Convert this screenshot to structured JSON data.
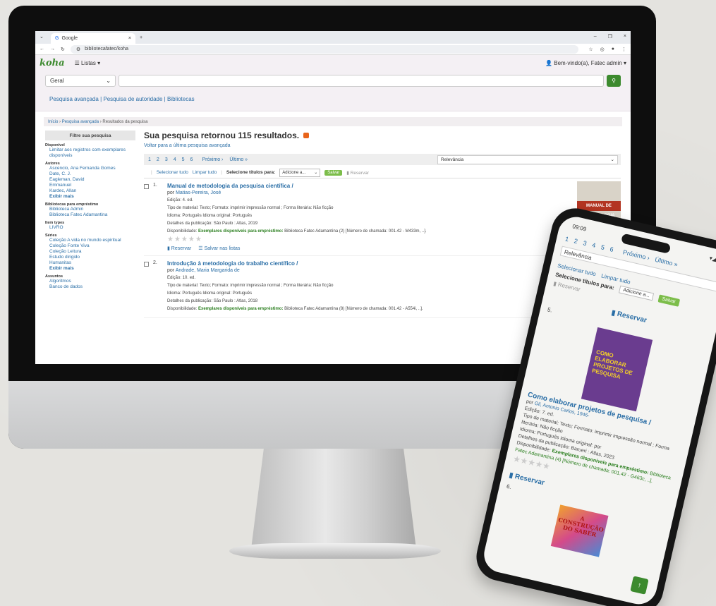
{
  "browser": {
    "tab_title": "Google",
    "url": "bibliotecafatec/koha"
  },
  "header": {
    "logo": "koha",
    "lists": "Listas",
    "welcome": "Bem-vindo(a), Fatec admin"
  },
  "search": {
    "index_selected": "Geral"
  },
  "links": {
    "advanced": "Pesquisa avançada",
    "authority": "Pesquisa de autoridade",
    "libraries": "Bibliotecas",
    "sep": "|"
  },
  "breadcrumb": {
    "home": "Início",
    "advanced": "Pesquisa avançada",
    "current": "Resultados da pesquisa"
  },
  "facets": {
    "title": "Filtre sua pesquisa",
    "groups": [
      {
        "label": "Disponível",
        "items": [
          "Limitar aos registros com exemplares disponíveis"
        ],
        "more": ""
      },
      {
        "label": "Autores",
        "items": [
          "Ascencio, Ana Fernanda Gomes",
          "Date, C. J.",
          "Eagleman, David",
          "Emmanuel",
          "Kardec, Allan"
        ],
        "more": "Exibir mais"
      },
      {
        "label": "Bibliotecas para empréstimo",
        "items": [
          "Biblioteca Admin",
          "Biblioteca Fatec Adamantina"
        ],
        "more": ""
      },
      {
        "label": "Item types",
        "items": [
          "LIVRO"
        ],
        "more": ""
      },
      {
        "label": "Séries",
        "items": [
          "Coleção A vida no mundo espiritual",
          "Coleção Fonte Viva",
          "Coleção Leitura",
          "Estudo dirigido",
          "Humanitas"
        ],
        "more": "Exibir mais"
      },
      {
        "label": "Assuntos",
        "items": [
          "Algoritmos",
          "Banco de dados"
        ],
        "more": ""
      }
    ]
  },
  "results": {
    "heading": "Sua pesquisa retornou 115 resultados.",
    "back_link": "Voltar para a última pesquisa avançada",
    "pages": [
      "1",
      "2",
      "3",
      "4",
      "5",
      "6"
    ],
    "next": "Próximo ›",
    "last": "Último »",
    "sort": "Relevância",
    "select_all": "Selecionar tudo",
    "clear_all": "Limpar tudo",
    "select_for": "Selecione títulos para:",
    "add_to": "Adicione a...",
    "save": "Salvar",
    "reserve": "Reservar",
    "records": [
      {
        "num": "1.",
        "title": "Manual de metodologia da pesquisa científica /",
        "by": "por",
        "author": "Matias-Pereira, José",
        "edition": "Edição: 4. ed.",
        "material": "Tipo de material: Texto; Formato: imprimir impressão normal ; Forma literária: Não ficção",
        "language": "Idioma: Português Idioma original: Português",
        "publication": "Detalhes da publicação: São Paulo : Atlas, 2019",
        "availability_label": "Disponibilidade:",
        "availability": "Exemplares disponíveis para empréstimo:",
        "availability_detail": "Biblioteca Fatec Adamantina (2) [Número de chamada: 001.42 - M433m, ..].",
        "reserve": "Reservar",
        "save_lists": "Salvar nas listas",
        "cover_text": "MANUAL DE METODOLOGIA"
      },
      {
        "num": "2.",
        "title": "Introdução à metodologia do trabalho científico /",
        "by": "por",
        "author": "Andrade, Maria Margarida de",
        "edition": "Edição: 10. ed.",
        "material": "Tipo de material: Texto; Formato: imprimir impressão normal ; Forma literária: Não ficção",
        "language": "Idioma: Português Idioma original: Português",
        "publication": "Detalhes da publicação: São Paulo : Atlas, 2018",
        "availability_label": "Disponibilidade:",
        "availability": "Exemplares disponíveis para empréstimo:",
        "availability_detail": "Biblioteca Fatec Adamantina (8) [Número de chamada: 001.42 - A554i, ..].",
        "reserve": "",
        "save_lists": "",
        "cover_text": ""
      }
    ]
  },
  "phone": {
    "time": "09:09",
    "pages": [
      "1",
      "2",
      "3",
      "4",
      "5",
      "6"
    ],
    "next": "Próximo ›",
    "last": "Último »",
    "sort": "Relevância",
    "select_all": "Selecionar tudo",
    "clear_all": "Limpar tudo",
    "select_for": "Selecione títulos para:",
    "add_to": "Adicione a...",
    "save": "Salvar",
    "reserve": "Reservar",
    "item5": {
      "num": "5.",
      "cover_text": "COMO ELABORAR PROJETOS DE PESQUISA",
      "title": "Como elaborar projetos de pesquisa /",
      "by": "por",
      "author": "Gil, Antonio Carlos, 1946-",
      "edition": "Edição: 7. ed.",
      "material": "Tipo de material: Texto; Formato: imprimir impressão normal ; Forma literária: Não ficção",
      "language": "Idioma: Português Idioma original: por",
      "publication": "Detalhes da publicação: Barueri : Atlas, 2023",
      "availability_label": "Disponibilidade:",
      "availability": "Exemplares disponíveis para empréstimo:",
      "availability_detail": "Biblioteca Fatec Adamantina (4) [Número de chamada: 001.42 - G463c, ..].",
      "reserve": "Reservar"
    },
    "item6": {
      "num": "6.",
      "cover_text": "A CONSTRUÇÃO DO SABER"
    }
  },
  "colors": {
    "koha_green": "#3c8a2e",
    "link_blue": "#2a6ea6",
    "available_green": "#2a7e1e",
    "rss_orange": "#e8641b"
  }
}
